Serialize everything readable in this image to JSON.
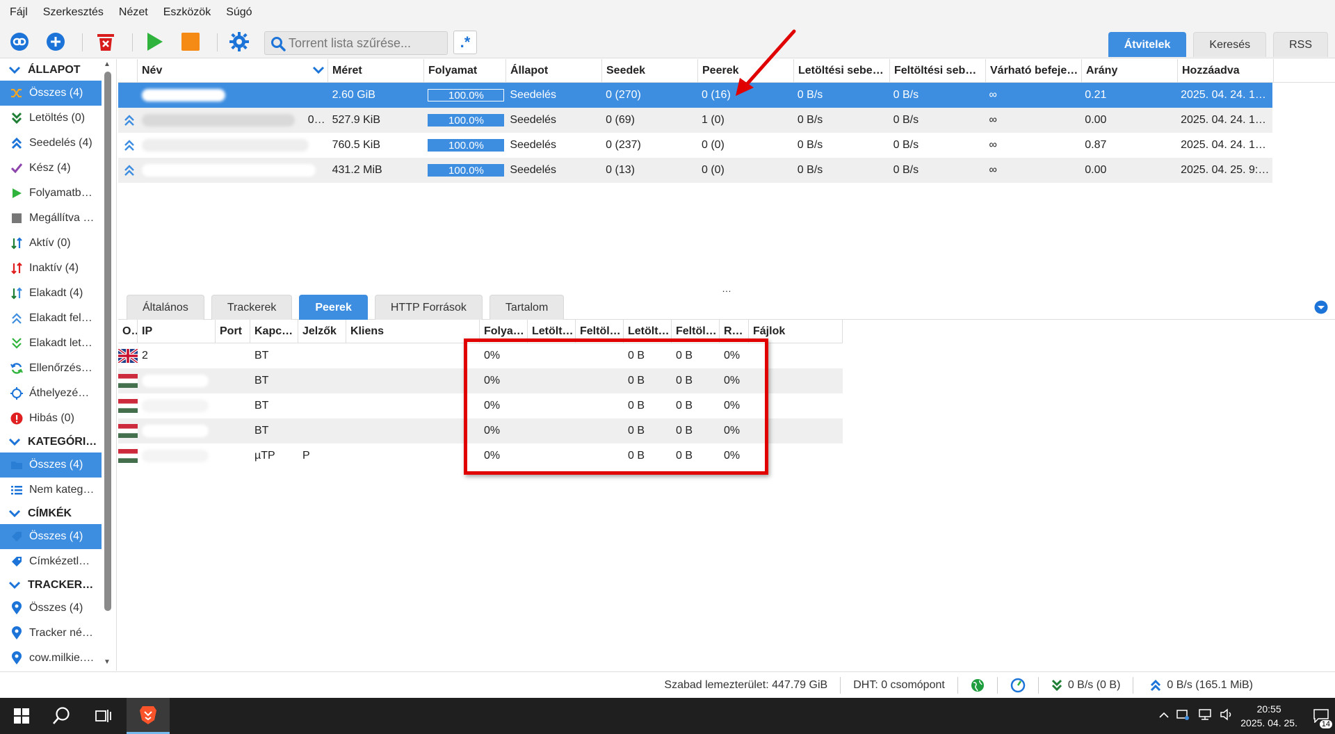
{
  "menu": [
    "Fájl",
    "Szerkesztés",
    "Nézet",
    "Eszközök",
    "Súgó"
  ],
  "search": {
    "placeholder": "Torrent lista szűrése..."
  },
  "right_tabs": [
    "Átvitelek",
    "Keresés",
    "RSS"
  ],
  "sidebar": {
    "status_header": "ÁLLAPOT",
    "status_items": [
      {
        "label": "Összes (4)",
        "icon": "shuffle-icon"
      },
      {
        "label": "Letöltés (0)",
        "icon": "download-chevrons-icon"
      },
      {
        "label": "Seedelés (4)",
        "icon": "upload-chevrons-icon"
      },
      {
        "label": "Kész (4)",
        "icon": "checkmark-icon"
      },
      {
        "label": "Folyamatb…",
        "icon": "play-icon"
      },
      {
        "label": "Megállítva …",
        "icon": "stop-icon"
      },
      {
        "label": "Aktív (0)",
        "icon": "active-arrows-icon"
      },
      {
        "label": "Inaktív (4)",
        "icon": "inactive-arrows-icon"
      },
      {
        "label": "Elakadt (4)",
        "icon": "stalled-arrows-icon"
      },
      {
        "label": "Elakadt fel…",
        "icon": "stalled-upload-icon"
      },
      {
        "label": "Elakadt let…",
        "icon": "stalled-download-icon"
      },
      {
        "label": "Ellenőrzés…",
        "icon": "checking-icon"
      },
      {
        "label": "Áthelyezé…",
        "icon": "moving-icon"
      },
      {
        "label": "Hibás (0)",
        "icon": "error-icon"
      }
    ],
    "category_header": "KATEGÓRI…",
    "category_items": [
      {
        "label": "Összes (4)",
        "icon": "folder-icon"
      },
      {
        "label": "Nem kateg…",
        "icon": "list-icon"
      }
    ],
    "tags_header": "CÍMKÉK",
    "tag_items": [
      {
        "label": "Összes (4)",
        "icon": "tag-icon"
      },
      {
        "label": "Címkézetl…",
        "icon": "tag-icon"
      }
    ],
    "tracker_header": "TRACKER…",
    "tracker_items": [
      {
        "label": "Összes (4)",
        "icon": "pin-icon"
      },
      {
        "label": "Tracker né…",
        "icon": "pin-icon"
      },
      {
        "label": "cow.milkie.…",
        "icon": "pin-icon"
      }
    ]
  },
  "torrents": {
    "columns": [
      "Név",
      "Méret",
      "Folyamat",
      "Állapot",
      "Seedek",
      "Peerek",
      "Letöltési sebe…",
      "Feltöltési seb…",
      "Várható befeje…",
      "Arány",
      "Hozzáadva"
    ],
    "rows": [
      {
        "name_fragment": "",
        "size": "2.60 GiB",
        "progress": "100.0%",
        "state": "Seedelés",
        "seeds": "0 (270)",
        "peers": "0 (16)",
        "dl": "0 B/s",
        "ul": "0 B/s",
        "eta": "∞",
        "ratio": "0.21",
        "added": "2025. 04. 24. 1…"
      },
      {
        "name_fragment": "0…",
        "size": "527.9 KiB",
        "progress": "100.0%",
        "state": "Seedelés",
        "seeds": "0 (69)",
        "peers": "1 (0)",
        "dl": "0 B/s",
        "ul": "0 B/s",
        "eta": "∞",
        "ratio": "0.00",
        "added": "2025. 04. 24. 1…"
      },
      {
        "name_fragment": "",
        "size": "760.5 KiB",
        "progress": "100.0%",
        "state": "Seedelés",
        "seeds": "0 (237)",
        "peers": "0 (0)",
        "dl": "0 B/s",
        "ul": "0 B/s",
        "eta": "∞",
        "ratio": "0.87",
        "added": "2025. 04. 24. 1…"
      },
      {
        "name_fragment": "",
        "size": "431.2 MiB",
        "progress": "100.0%",
        "state": "Seedelés",
        "seeds": "0 (13)",
        "peers": "0 (0)",
        "dl": "0 B/s",
        "ul": "0 B/s",
        "eta": "∞",
        "ratio": "0.00",
        "added": "2025. 04. 25. 9:…"
      }
    ]
  },
  "detail_tabs": [
    "Általános",
    "Trackerek",
    "Peerek",
    "HTTP Források",
    "Tartalom"
  ],
  "peers": {
    "columns": [
      "O…",
      "IP",
      "Port",
      "Kapc…",
      "Jelzők",
      "Kliens",
      "Folya…",
      "Letölt…",
      "Feltöl…",
      "Letölt…",
      "Feltöl…",
      "R…",
      "Fájlok"
    ],
    "rows": [
      {
        "flag": "uk",
        "ip": "2",
        "port": "",
        "conn": "BT",
        "flags": "",
        "progress": "0%",
        "down": "0 B",
        "up": "0 B",
        "relevance": "0%"
      },
      {
        "flag": "hu",
        "ip": "",
        "port": "",
        "conn": "BT",
        "flags": "",
        "progress": "0%",
        "down": "0 B",
        "up": "0 B",
        "relevance": "0%"
      },
      {
        "flag": "hu",
        "ip": "",
        "port": "",
        "conn": "BT",
        "flags": "",
        "progress": "0%",
        "down": "0 B",
        "up": "0 B",
        "relevance": "0%"
      },
      {
        "flag": "hu",
        "ip": "",
        "port": "",
        "conn": "BT",
        "flags": "",
        "progress": "0%",
        "down": "0 B",
        "up": "0 B",
        "relevance": "0%"
      },
      {
        "flag": "hu",
        "ip": "",
        "port": "",
        "conn": "µTP",
        "flags": "P",
        "progress": "0%",
        "down": "0 B",
        "up": "0 B",
        "relevance": "0%"
      }
    ]
  },
  "status": {
    "free_space": "Szabad lemezterület: 447.79 GiB",
    "dht": "DHT: 0 csomópont",
    "download": "0 B/s (0 B)",
    "upload": "0 B/s (165.1 MiB)"
  },
  "taskbar": {
    "time": "20:55",
    "date": "2025. 04. 25.",
    "notifications": "14"
  },
  "colors": {
    "accent": "#3d8de0",
    "highlight": "#e00000"
  }
}
